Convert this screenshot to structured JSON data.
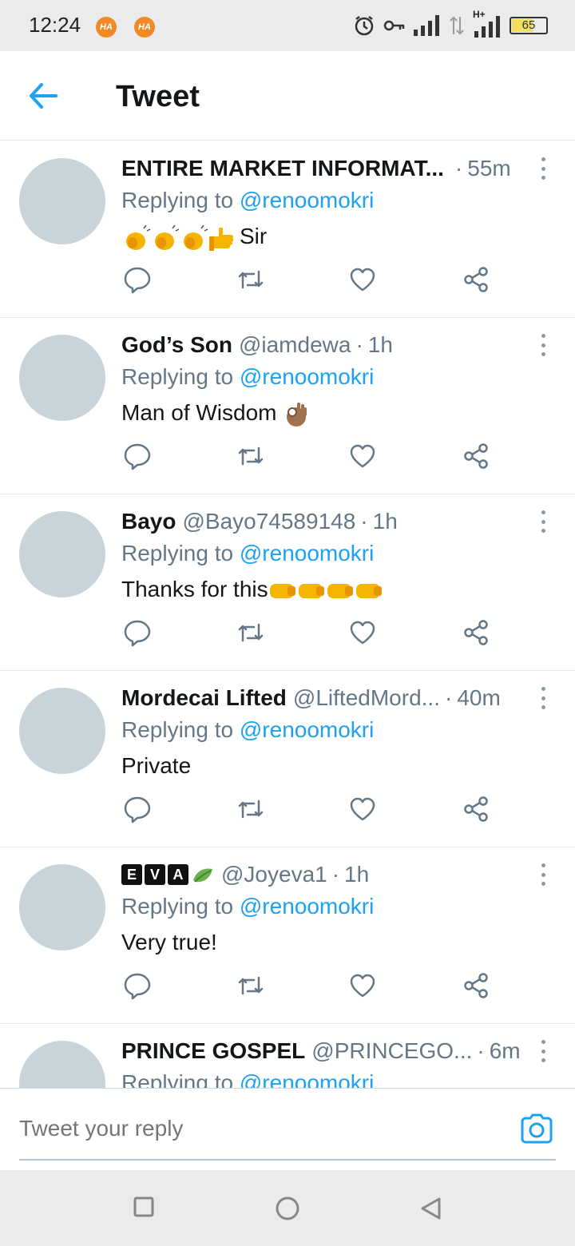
{
  "status_bar": {
    "time": "12:24",
    "badges": [
      "HA",
      "HA"
    ],
    "network": "H+",
    "battery": "65"
  },
  "header": {
    "title": "Tweet"
  },
  "tweets": [
    {
      "name": "ENTIRE MARKET INFORMAT...",
      "handle": "",
      "time": "55m",
      "replying_label": "Replying to",
      "mention": "@renoomokri",
      "text": "Sir"
    },
    {
      "name": "God’s Son",
      "handle": "@iamdewa",
      "time": "1h",
      "replying_label": "Replying to",
      "mention": "@renoomokri",
      "text": "Man of Wisdom"
    },
    {
      "name": "Bayo",
      "handle": "@Bayo74589148",
      "time": "1h",
      "replying_label": "Replying to",
      "mention": "@renoomokri",
      "text": "Thanks for this"
    },
    {
      "name": "Mordecai Lifted",
      "handle": "@LiftedMord...",
      "time": "40m",
      "replying_label": "Replying to",
      "mention": "@renoomokri",
      "text": "Private"
    },
    {
      "name_letters": [
        "E",
        "V",
        "A"
      ],
      "handle": "@Joyeva1",
      "time": "1h",
      "replying_label": "Replying to",
      "mention": "@renoomokri",
      "text": "Very true!"
    },
    {
      "name": "PRINCE GOSPEL",
      "handle": "@PRINCEGO...",
      "time": "6m",
      "replying_label": "Replying to",
      "mention": "@renoomokri",
      "text": ""
    }
  ],
  "reply_bar": {
    "placeholder": "Tweet your reply"
  },
  "colors": {
    "accent": "#1da1f2",
    "secondary_text": "#657786",
    "avatar": "#c9d3da",
    "divider": "#e1e8ed"
  },
  "icons": {
    "back": "arrow-left-icon",
    "more": "vertical-dots-icon",
    "reply": "speech-bubble-icon",
    "retweet": "retweet-icon",
    "like": "heart-icon",
    "share": "share-icon",
    "camera": "camera-icon"
  }
}
